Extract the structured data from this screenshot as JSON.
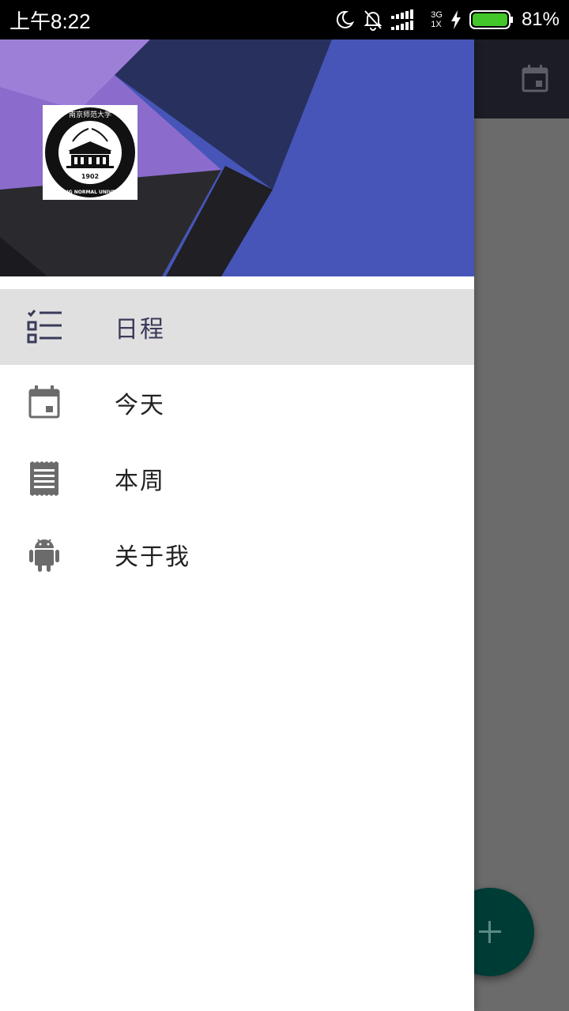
{
  "status_bar": {
    "time": "上午8:22",
    "network_top": "3G",
    "network_bottom": "1X",
    "battery_percent": "81%",
    "icons": [
      "moon-icon",
      "bell-off-icon",
      "signal-icon",
      "charging-icon",
      "battery-icon"
    ]
  },
  "drawer": {
    "header": {
      "logo": {
        "text_top": "南京师范大学",
        "text_bottom": "NANJING NORMAL UNIVERSITY",
        "year": "1902"
      }
    },
    "menu": [
      {
        "label": "日程",
        "icon": "checklist-icon",
        "active": true
      },
      {
        "label": "今天",
        "icon": "calendar-today-icon",
        "active": false
      },
      {
        "label": "本周",
        "icon": "receipt-icon",
        "active": false
      },
      {
        "label": "关于我",
        "icon": "android-icon",
        "active": false
      }
    ]
  },
  "app": {
    "toolbar_icon": "calendar-icon",
    "fab_icon": "plus-icon"
  },
  "colors": {
    "header_blue": "#4655b7",
    "header_purple": "#8e6fcf",
    "header_navy": "#28315e",
    "active_item_bg": "#e0e0e0",
    "fab": "#003c36",
    "scrim": "#6b6b6b"
  }
}
